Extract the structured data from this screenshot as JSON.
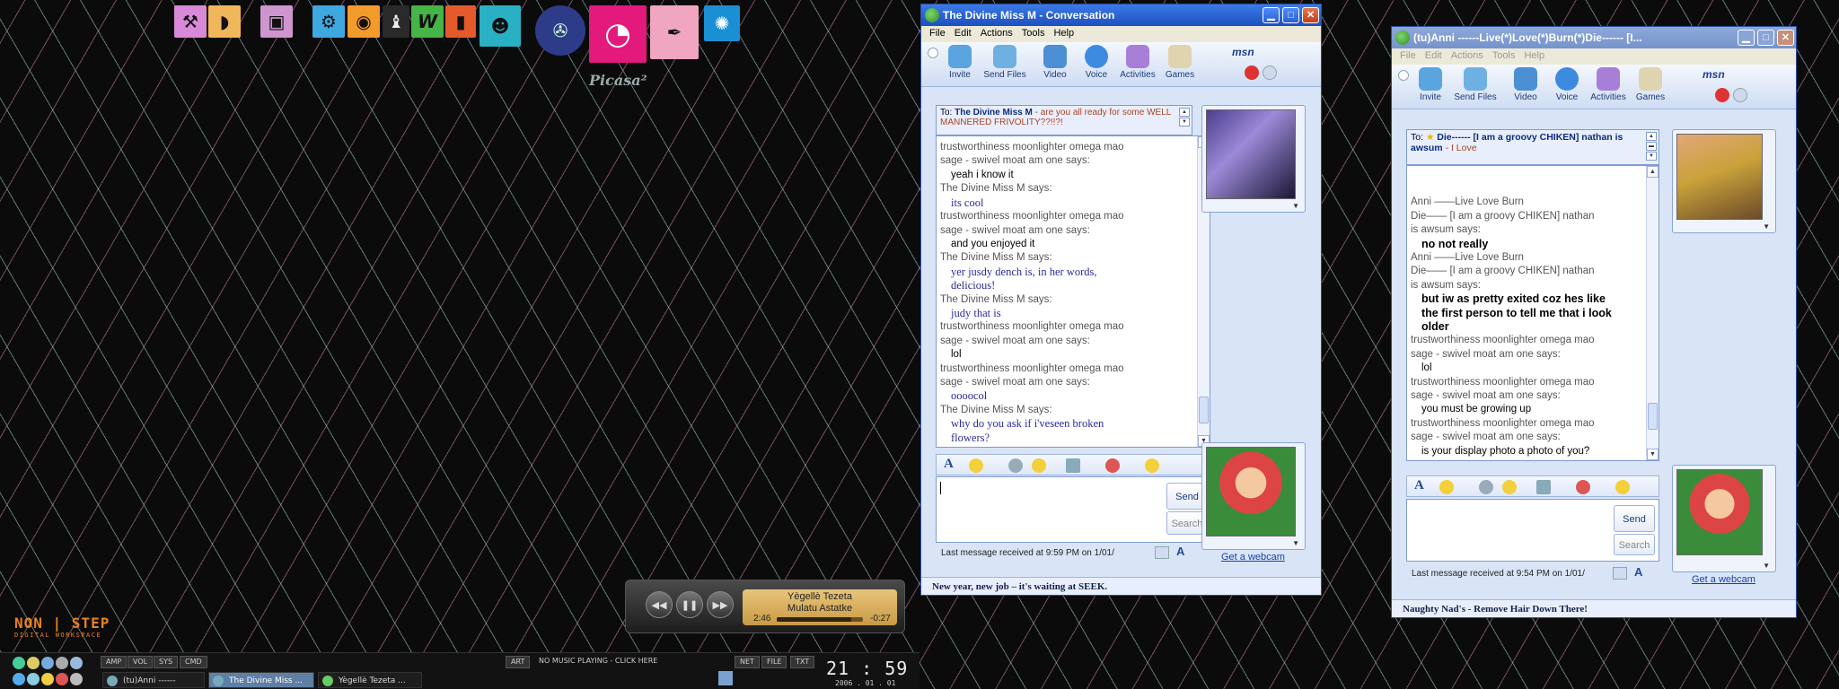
{
  "desktop": {
    "dock_icons": [
      "tools-icon",
      "lips-icon",
      "box-icon",
      "bike-icon",
      "record-icon",
      "chess-icon",
      "word-icon",
      "notebook-icon",
      "buddies-icon",
      "telephone-icon",
      "picasa-icon",
      "feather-icon",
      "splat-icon"
    ],
    "picasa_label": "Picasa²",
    "brand": {
      "big": "non | step",
      "small": "digital workspace"
    }
  },
  "player": {
    "line1": "Yègellè Tezeta",
    "line2": "Mulatu Astatke",
    "elapsed": "2:46",
    "remaining": "-0:27",
    "progress": 0.86
  },
  "taskbar": {
    "tabs": [
      "AMP",
      "VOL",
      "SYS",
      "CMD"
    ],
    "art_label": "ART",
    "now_playing": "NO MUSIC PLAYING - CLICK HERE",
    "right_tabs": [
      "NET",
      "FILE",
      "TXT"
    ],
    "tasks": [
      {
        "label": "(tu)Anni ------",
        "active": false
      },
      {
        "label": "The Divine Miss ...",
        "active": true
      },
      {
        "label": "Yègellè Tezeta ...",
        "active": false
      }
    ],
    "clock": "21 : 59",
    "date": "2006 . 01 . 01"
  },
  "conv1": {
    "title": "The Divine Miss M - Conversation",
    "menu": [
      "File",
      "Edit",
      "Actions",
      "Tools",
      "Help"
    ],
    "toolbar": [
      "Invite",
      "Send Files",
      "Video",
      "Voice",
      "Activities",
      "Games"
    ],
    "to_label": "To:",
    "to_name": "The Divine Miss M",
    "to_status": " - are you all ready for some WELL MANNERED FRIVOLITY??!!?!",
    "history": [
      {
        "type": "sys",
        "text": "trustworthiness moonlighter omega mao"
      },
      {
        "type": "sys",
        "text": "sage - swivel moat am one says:"
      },
      {
        "type": "me",
        "text": "yeah i know it"
      },
      {
        "type": "sys",
        "text": "The Divine Miss M says:"
      },
      {
        "type": "them",
        "text": "its cool"
      },
      {
        "type": "sys",
        "text": "trustworthiness moonlighter omega mao"
      },
      {
        "type": "sys",
        "text": "sage - swivel moat am one says:"
      },
      {
        "type": "me",
        "text": "and you enjoyed it"
      },
      {
        "type": "sys",
        "text": "The Divine Miss M says:"
      },
      {
        "type": "them",
        "text": "yer jusdy dench is, in her words,"
      },
      {
        "type": "them",
        "text": "delicious!"
      },
      {
        "type": "sys",
        "text": "The Divine Miss M says:"
      },
      {
        "type": "them",
        "text": "judy that is"
      },
      {
        "type": "sys",
        "text": "trustworthiness moonlighter omega mao"
      },
      {
        "type": "sys",
        "text": "sage - swivel moat am one says:"
      },
      {
        "type": "me",
        "text": "lol"
      },
      {
        "type": "sys",
        "text": "trustworthiness moonlighter omega mao"
      },
      {
        "type": "sys",
        "text": "sage - swivel moat am one says:"
      },
      {
        "type": "them",
        "text": "oooocol"
      },
      {
        "type": "sys",
        "text": "The Divine Miss M says:"
      },
      {
        "type": "them",
        "text": "why do you ask if i'veseen broken"
      },
      {
        "type": "them",
        "text": "flowers?"
      }
    ],
    "send_label": "Send",
    "search_label": "Search",
    "last_message": "Last message received at 9:59 PM on 1/01/",
    "webcam": "Get a webcam",
    "status_ad": "New year, new job – it's waiting at SEEK."
  },
  "conv2": {
    "title": "(tu)Anni        ------Live(*)Love(*)Burn(*)Die------      [I...",
    "menu": [
      "File",
      "Edit",
      "Actions",
      "Tools",
      "Help"
    ],
    "toolbar": [
      "Invite",
      "Send Files",
      "Video",
      "Voice",
      "Activities",
      "Games"
    ],
    "to_label": "To:",
    "to_text": "Die------      [I am a groovy CHIKEN]  nathan is awsum",
    "to_suffix": " - I Love",
    "history": [
      {
        "type": "sys",
        "text": "Anni        ——Live  Love  Burn"
      },
      {
        "type": "sys",
        "text": "Die——      [I am a groovy CHIKEN]  nathan"
      },
      {
        "type": "sys",
        "text": "is awsum    says:"
      },
      {
        "type": "anni",
        "text": "no not really"
      },
      {
        "type": "sys",
        "text": "Anni        ——Live  Love  Burn"
      },
      {
        "type": "sys",
        "text": "Die——      [I am a groovy CHIKEN]  nathan"
      },
      {
        "type": "sys",
        "text": "is awsum    says:"
      },
      {
        "type": "anni",
        "text": "but iw as pretty exited coz hes like"
      },
      {
        "type": "anni",
        "text": "the first person to tell me that i look"
      },
      {
        "type": "anni",
        "text": "older"
      },
      {
        "type": "sys",
        "text": "trustworthiness moonlighter omega mao"
      },
      {
        "type": "sys",
        "text": "sage - swivel moat am one says:"
      },
      {
        "type": "me",
        "text": "lol"
      },
      {
        "type": "sys",
        "text": "trustworthiness moonlighter omega mao"
      },
      {
        "type": "sys",
        "text": "sage - swivel moat am one says:"
      },
      {
        "type": "me",
        "text": "you must be growing up"
      },
      {
        "type": "sys",
        "text": "trustworthiness moonlighter omega mao"
      },
      {
        "type": "sys",
        "text": "sage - swivel moat am one says:"
      },
      {
        "type": "me",
        "text": "is your display photo a photo of you?"
      }
    ],
    "send_label": "Send",
    "search_label": "Search",
    "last_message": "Last message received at 9:54 PM on 1/01/",
    "webcam": "Get a webcam",
    "status_ad": "Naughty Nad's - Remove Hair Down There!"
  }
}
